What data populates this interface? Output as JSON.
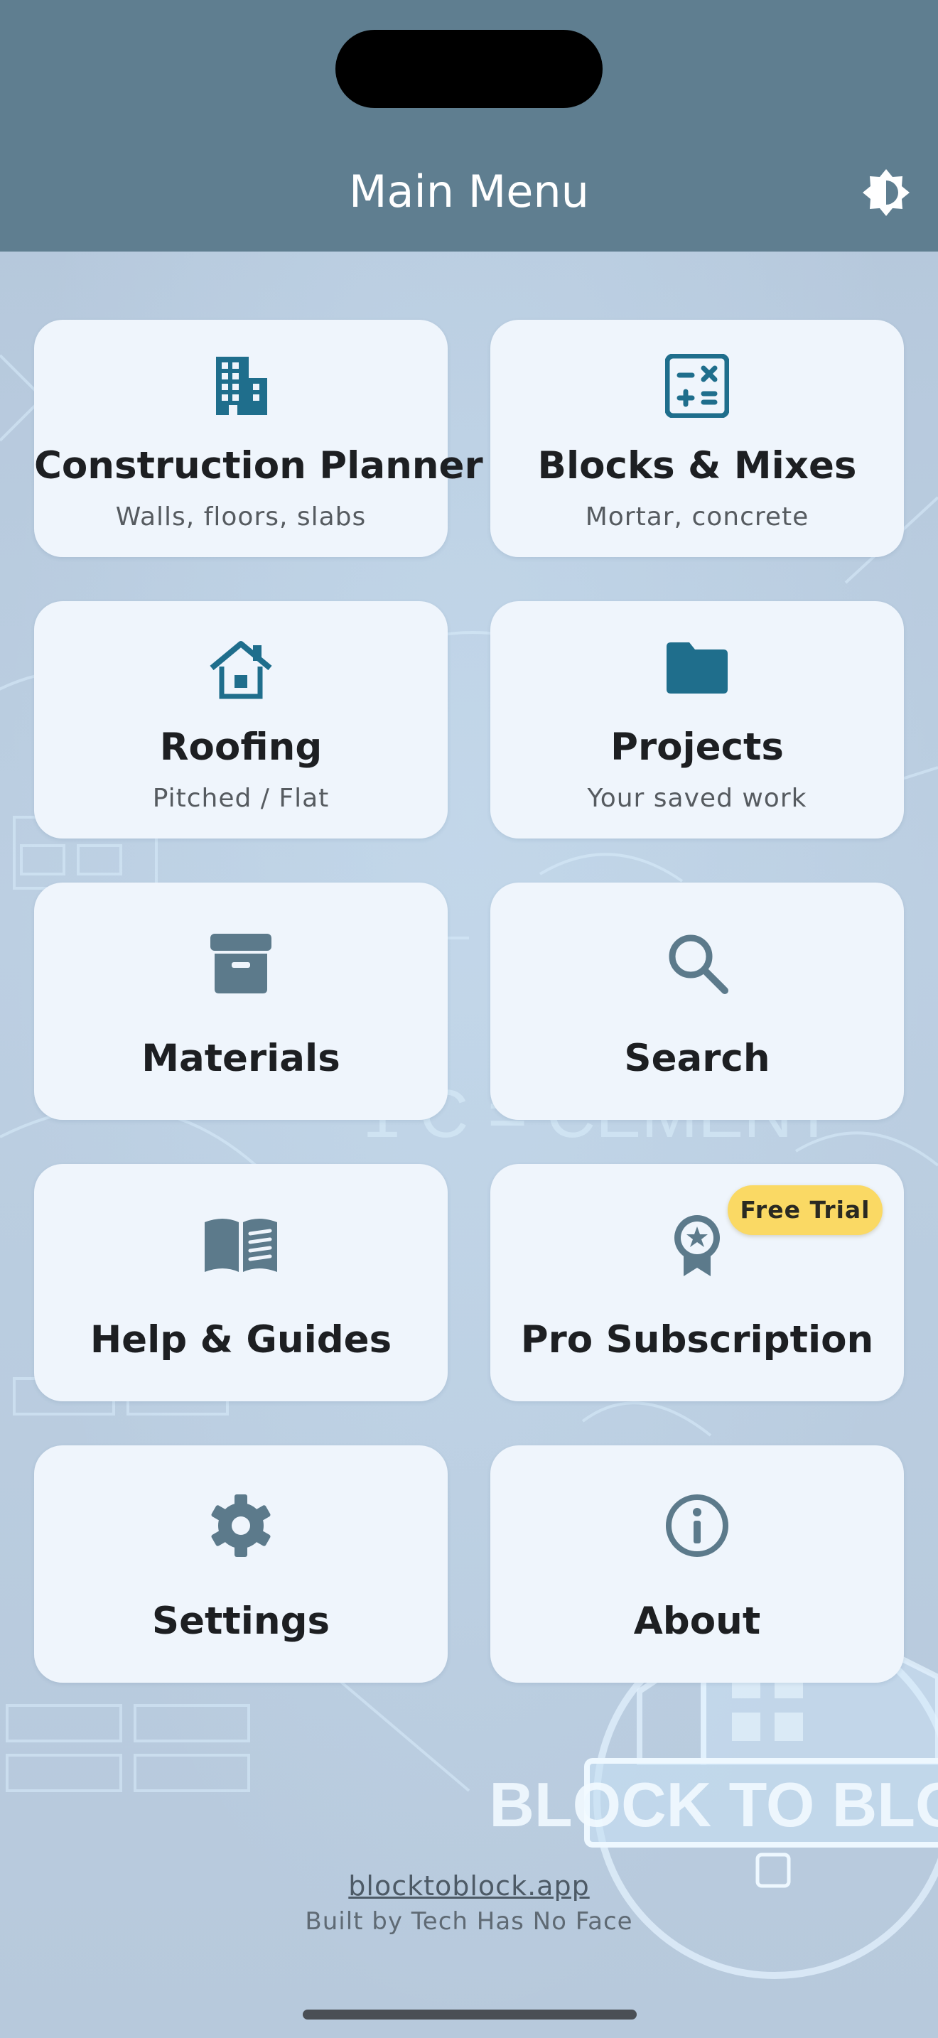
{
  "header": {
    "title": "Main Menu",
    "theme_icon": "brightness-icon"
  },
  "tiles": [
    {
      "label": "Construction Planner",
      "sub": "Walls, floors, slabs",
      "icon": "building-icon"
    },
    {
      "label": "Blocks & Mixes",
      "sub": "Mortar, concrete",
      "icon": "calculator-icon"
    },
    {
      "label": "Roofing",
      "sub": "Pitched / Flat",
      "icon": "house-icon"
    },
    {
      "label": "Projects",
      "sub": "Your saved work",
      "icon": "folder-icon"
    },
    {
      "label": "Materials",
      "icon": "archive-box-icon"
    },
    {
      "label": "Search",
      "icon": "search-icon"
    },
    {
      "label": "Help & Guides",
      "icon": "open-book-icon"
    },
    {
      "label": "Pro Subscription",
      "icon": "award-ribbon-icon",
      "badge": "Free Trial"
    },
    {
      "label": "Settings",
      "icon": "gear-icon"
    },
    {
      "label": "About",
      "icon": "info-icon"
    }
  ],
  "footer": {
    "link": "blocktoblock.app",
    "credit": "Built by Tech Has No Face"
  },
  "watermark": {
    "text": "BLOCK TO BLOCK"
  },
  "colors": {
    "header": "#5f7e90",
    "accent_teal": "#1f6e8c",
    "icon_slate": "#5c7a8b",
    "badge": "#fad964",
    "tile": "#eff5fc"
  }
}
